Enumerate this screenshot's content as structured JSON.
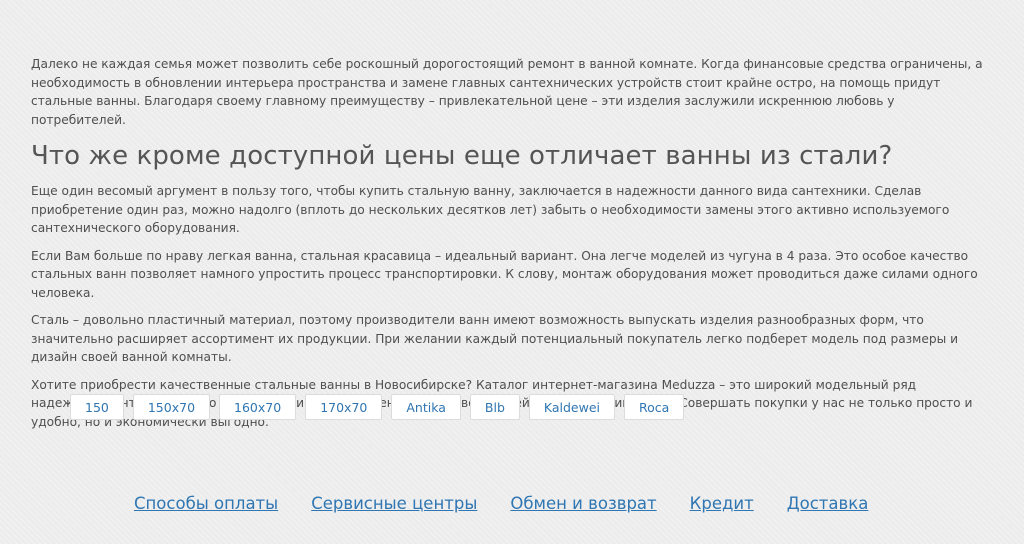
{
  "article": {
    "intro": "Далеко не каждая семья может позволить себе роскошный дорогостоящий ремонт в ванной комнате. Когда финансовые средства ограничены, а необходимость в обновлении интерьера пространства и замене главных сантехнических устройств стоит крайне остро, на помощь придут стальные ванны. Благодаря своему главному преимуществу – привлекательной цене – эти изделия заслужили искреннюю любовь у потребителей.",
    "heading": "Что же кроме доступной цены еще отличает ванны из стали?",
    "paragraphs": [
      "Еще один весомый аргумент в пользу того, чтобы купить стальную ванну, заключается в надежности данного вида сантехники. Сделав приобретение один раз, можно надолго (вплоть до нескольких десятков лет) забыть о необходимости замены этого активно используемого сантехнического оборудования.",
      "Если Вам больше по нраву легкая ванна, стальная красавица – идеальный вариант. Она легче моделей из чугуна в 4 раза. Это особое качество стальных ванн позволяет намного упростить процесс транспортировки. К слову, монтаж оборудования может проводиться даже силами одного человека.",
      "Сталь – довольно пластичный материал, поэтому производители ванн имеют возможность выпускать изделия разнообразных форм, что значительно расширяет ассортимент их продукции. При желании каждый потенциальный покупатель легко подберет модель под размеры и дизайн своей ванной комнаты.",
      "Хотите приобрести качественные стальные ванны в Новосибирске? Каталог интернет-магазина Meduzza – это широкий модельный ряд надежного сантехнического оборудования от проверенных производителей с мировыми именами. Совершать покупки у нас не только просто и удобно, но и экономически выгодно."
    ]
  },
  "tags": [
    "150",
    "150х70",
    "160х70",
    "170х70",
    "Antika",
    "Blb",
    "Kaldewei",
    "Roca"
  ],
  "footer_links": [
    "Способы оплаты",
    "Сервисные центры",
    "Обмен и возврат",
    "Кредит",
    "Доставка"
  ],
  "colors": {
    "link": "#2f76b2",
    "text": "#4f4f4f",
    "background": "#ececec"
  }
}
